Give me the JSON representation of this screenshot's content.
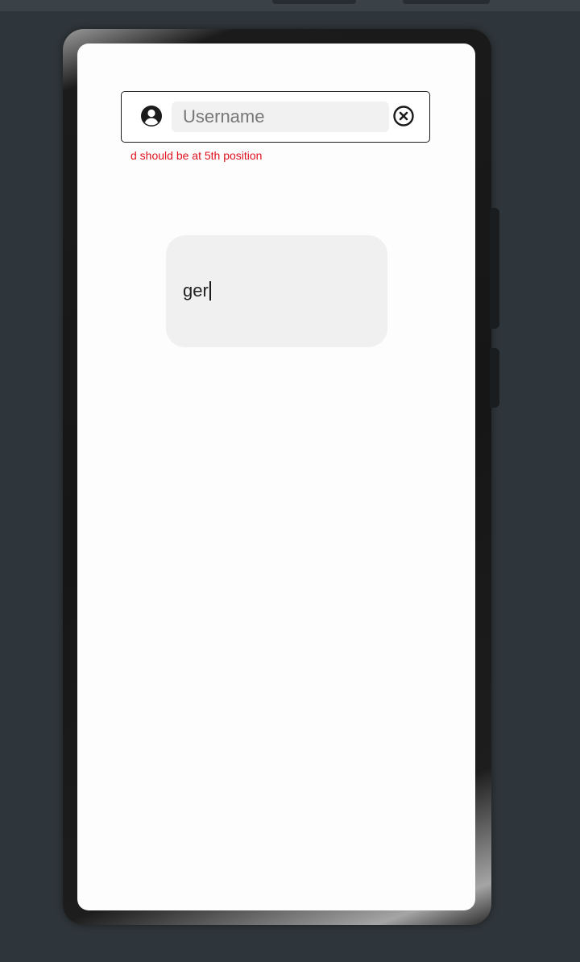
{
  "username_field": {
    "placeholder": "Username",
    "value": "",
    "leading_icon": "account-circle-icon",
    "trailing_icon": "clear-circle-icon"
  },
  "validation": {
    "error_message": "d should be at 5th position",
    "error_color": "#e0101e"
  },
  "text_card": {
    "value": "ger",
    "background": "#f0f0f0"
  }
}
